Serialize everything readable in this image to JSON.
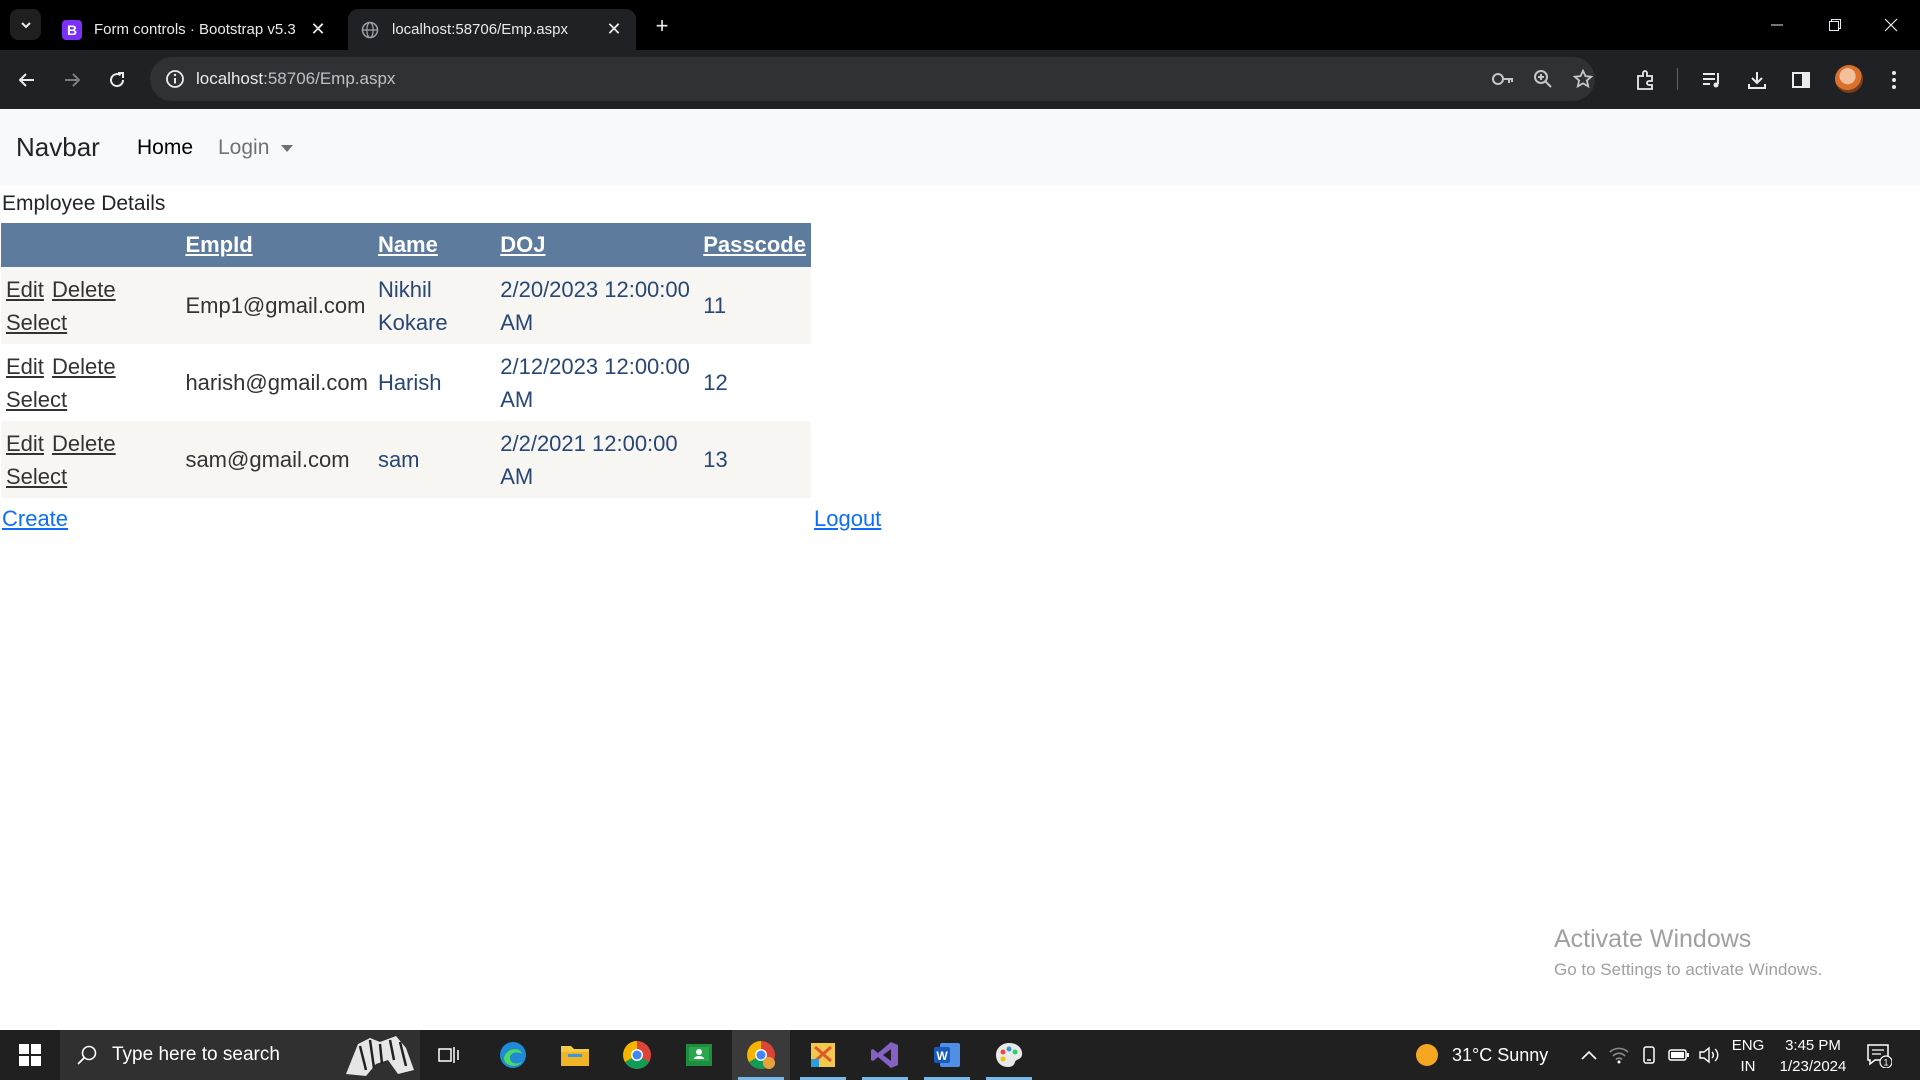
{
  "browser": {
    "tabs": [
      {
        "title": "Form controls · Bootstrap v5.3",
        "favicon": "bootstrap-icon",
        "favicon_text": "B",
        "active": false
      },
      {
        "title": "localhost:58706/Emp.aspx",
        "favicon": "globe-icon",
        "active": true
      }
    ],
    "url_host": "localhost",
    "url_rest": ":58706/Emp.aspx"
  },
  "page": {
    "navbar": {
      "brand": "Navbar",
      "home_label": "Home",
      "login_label": "Login"
    },
    "heading": "Employee Details",
    "table": {
      "headers": [
        "",
        "EmpId",
        "Name",
        "DOJ",
        "Passcode"
      ],
      "commands": [
        "Edit",
        "Delete",
        "Select"
      ],
      "rows": [
        {
          "empid": "Emp1@gmail.com",
          "name": "Nikhil Kokare",
          "doj": "2/20/2023 12:00:00 AM",
          "passcode": "11"
        },
        {
          "empid": "harish@gmail.com",
          "name": "Harish",
          "doj": "2/12/2023 12:00:00 AM",
          "passcode": "12"
        },
        {
          "empid": "sam@gmail.com",
          "name": "sam",
          "doj": "2/2/2021 12:00:00 AM",
          "passcode": "13"
        }
      ]
    },
    "create_label": "Create",
    "logout_label": "Logout"
  },
  "watermark": {
    "line1": "Activate Windows",
    "line2": "Go to Settings to activate Windows."
  },
  "taskbar": {
    "search_placeholder": "Type here to search",
    "weather": "31°C  Sunny",
    "lang_line1": "ENG",
    "lang_line2": "IN",
    "time": "3:45 PM",
    "date": "1/23/2024",
    "notification_count": "1"
  },
  "colors": {
    "grid_header": "#5d7b9d",
    "grid_alt_row": "#f7f6f3",
    "link": "#0d6efd",
    "navbar_bg": "#f8f9fa"
  }
}
